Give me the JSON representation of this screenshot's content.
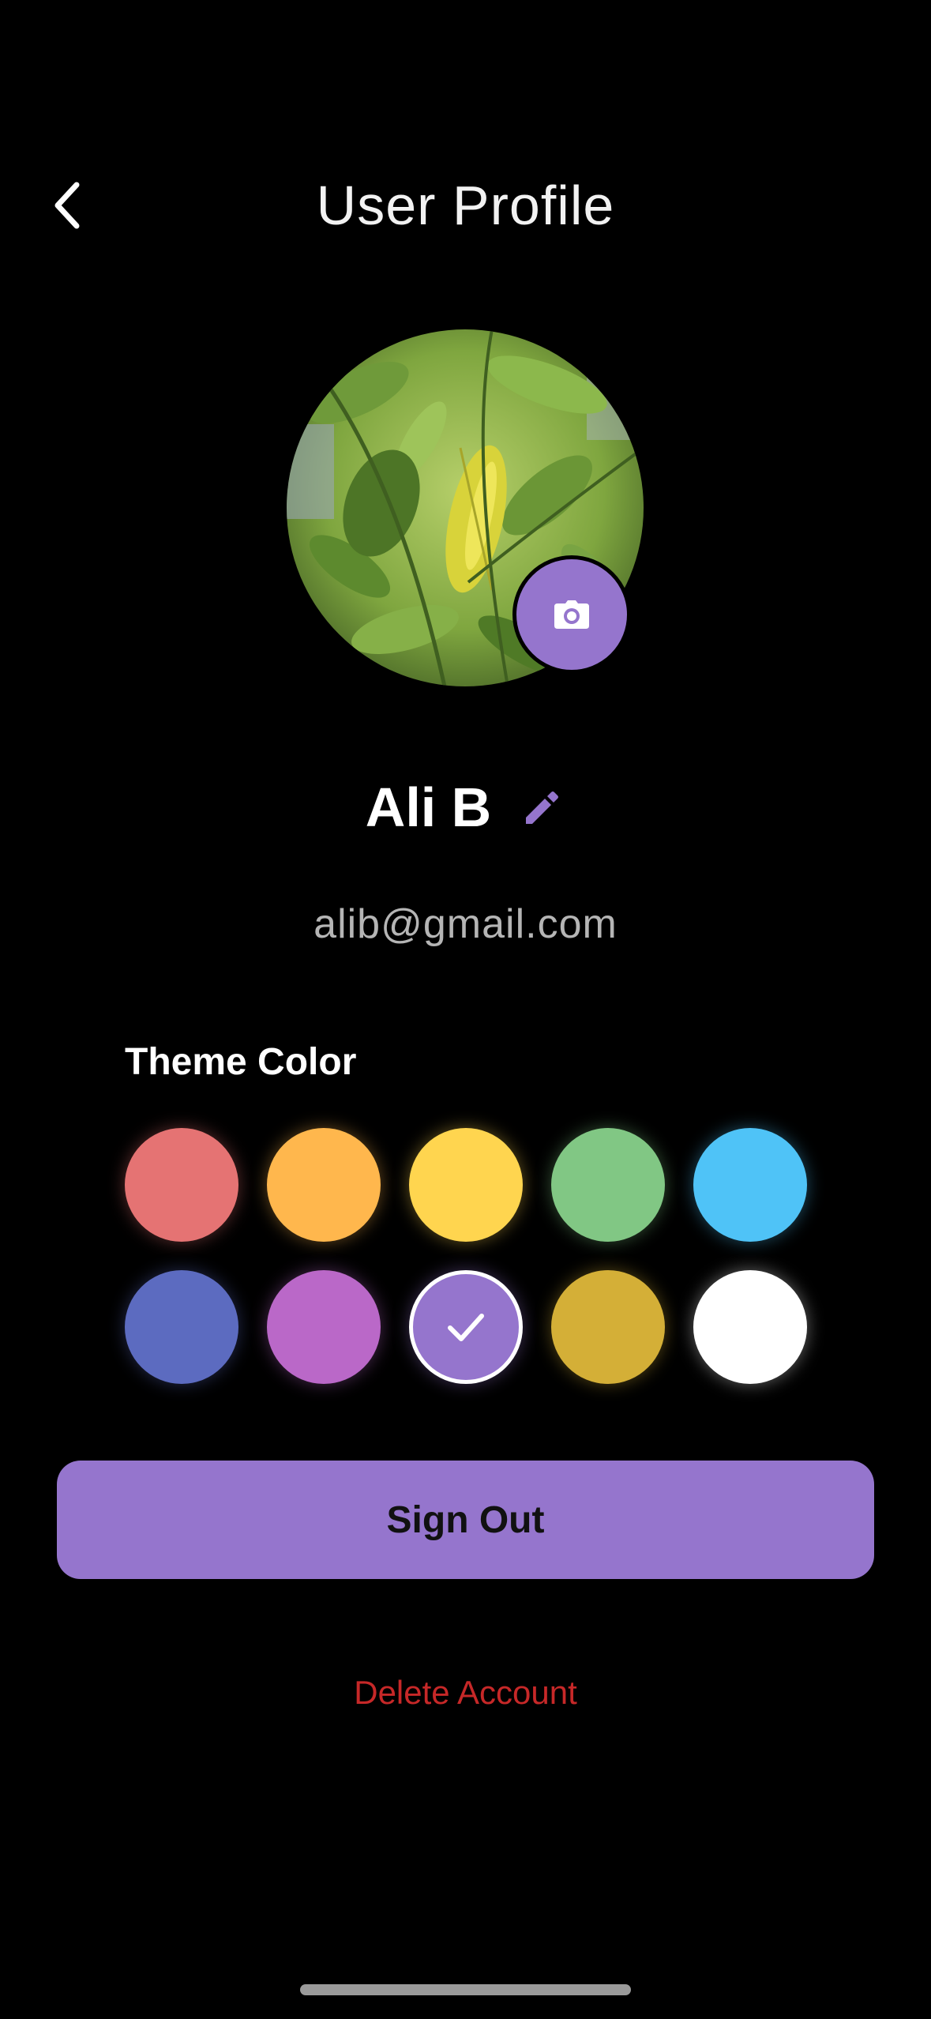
{
  "header": {
    "title": "User Profile",
    "back_icon": "chevron-left-icon"
  },
  "profile": {
    "avatar": "leaf-photo",
    "camera_icon": "camera-icon",
    "name": "Ali B",
    "edit_icon": "pencil-icon",
    "email": "alib@gmail.com"
  },
  "theme": {
    "label": "Theme Color",
    "selected_index": 7,
    "swatches": [
      {
        "color": "#e57373",
        "name": "red"
      },
      {
        "color": "#ffb74d",
        "name": "orange"
      },
      {
        "color": "#ffd54f",
        "name": "yellow"
      },
      {
        "color": "#81c784",
        "name": "green"
      },
      {
        "color": "#4fc3f7",
        "name": "light-blue"
      },
      {
        "color": "#5c6bc0",
        "name": "indigo"
      },
      {
        "color": "#ba68c8",
        "name": "purple"
      },
      {
        "color": "#9575cd",
        "name": "lavender"
      },
      {
        "color": "#d4af37",
        "name": "gold"
      },
      {
        "color": "#ffffff",
        "name": "white"
      }
    ]
  },
  "actions": {
    "sign_out": "Sign Out",
    "delete_account": "Delete Account"
  },
  "colors": {
    "accent": "#9575cd",
    "danger": "#c62828",
    "background": "#000000"
  }
}
